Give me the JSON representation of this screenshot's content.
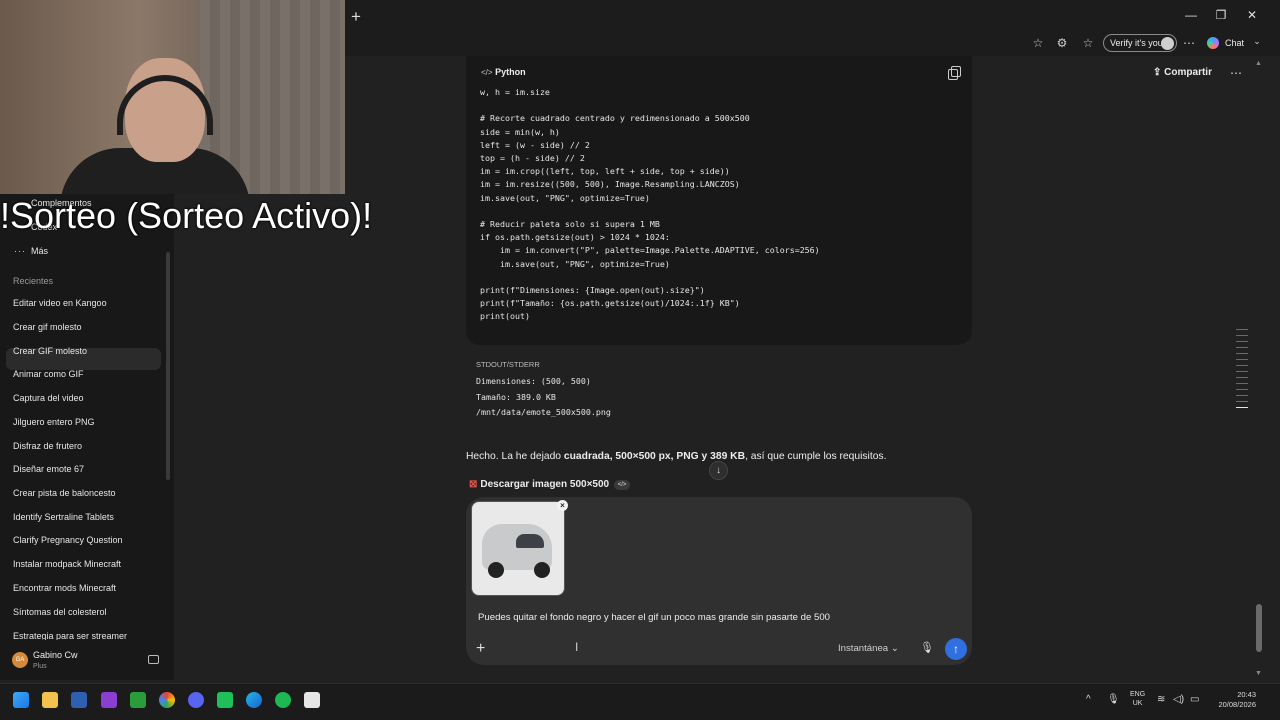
{
  "browser": {
    "new_tab": "+",
    "verify_label": "Verify it's you",
    "chat_label": "Chat",
    "window_controls": [
      "—",
      "❐",
      "✕"
    ]
  },
  "stream_overlay": {
    "banner": "!Sorteo (Sorteo Activo)!"
  },
  "sidebar": {
    "top_items": [
      "Complementos",
      "Codex"
    ],
    "more_label": "Más",
    "recent_heading": "Recientes",
    "recents": [
      "Editar video en Kangoo",
      "Crear gif molesto",
      "Crear GIF molesto",
      "Animar como GIF",
      "Captura del video",
      "Jilguero entero PNG",
      "Disfraz de frutero",
      "Diseñar emote 67",
      "Crear pista de baloncesto",
      "Identify Sertraline Tablets",
      "Clarify Pregnancy Question",
      "Instalar modpack Minecraft",
      "Encontrar mods Minecraft",
      "Síntomas del colesterol",
      "Estrategia para ser streamer"
    ],
    "user": {
      "name": "Gabino Cw",
      "plan": "Plus",
      "initials": "GA"
    }
  },
  "header": {
    "share_label": "Compartir",
    "more_icon": "⋯"
  },
  "code_block": {
    "language": "Python",
    "lines": [
      "w, h = im.size",
      "",
      "# Recorte cuadrado centrado y redimensionado a 500x500",
      "side = min(w, h)",
      "left = (w - side) // 2",
      "top = (h - side) // 2",
      "im = im.crop((left, top, left + side, top + side))",
      "im = im.resize((500, 500), Image.Resampling.LANCZOS)",
      "im.save(out, \"PNG\", optimize=True)",
      "",
      "# Reducir paleta solo si supera 1 MB",
      "if os.path.getsize(out) > 1024 * 1024:",
      "    im = im.convert(\"P\", palette=Image.Palette.ADAPTIVE, colors=256)",
      "    im.save(out, \"PNG\", optimize=True)",
      "",
      "print(f\"Dimensiones: {Image.open(out).size}\")",
      "print(f\"Tamaño: {os.path.getsize(out)/1024:.1f} KB\")",
      "print(out)"
    ]
  },
  "output": {
    "label": "STDOUT/STDERR",
    "lines": [
      "Dimensiones: (500, 500)",
      "Tamaño: 389.0 KB",
      "/mnt/data/emote_500x500.png"
    ]
  },
  "answer": {
    "prefix": "Hecho. La he dejado ",
    "bold": "cuadrada, 500×500 px, PNG y 389 KB",
    "suffix": ", así que cumple los requisitos."
  },
  "download": {
    "label": "Descargar imagen 500×500",
    "code_badge": "</>"
  },
  "composer": {
    "prompt": "Puedes quitar el fondo negro y hacer el gif un poco mas grande sin pasarte de 500",
    "mode": "Instantánea",
    "add": "+",
    "send": "↑"
  },
  "taskbar": {
    "lang": "ENG",
    "region": "UK",
    "time": "20:43",
    "date": "20/08/2026"
  }
}
